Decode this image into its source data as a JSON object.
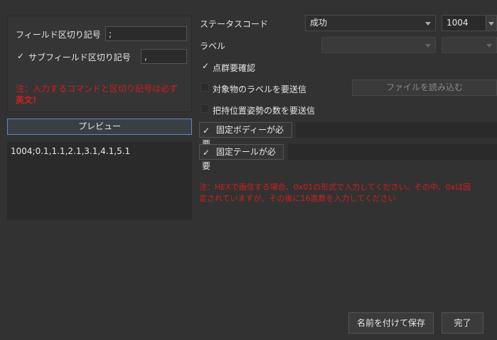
{
  "left": {
    "field_delimiter_label": "フィールド区切り記号",
    "field_delimiter_value": ";",
    "subfield_checkbox_checked": true,
    "subfield_delimiter_label": "サブフィールド区切り記号",
    "subfield_delimiter_value": ",",
    "note_line1": "注：入力するコマンドと区切り記号は必ず",
    "note_line2": "英文!",
    "preview_button": "プレビュー",
    "preview_text": "1004;0.1,1.1,2.1,3.1,4.1,5.1"
  },
  "right": {
    "status_code_label": "ステータスコード",
    "status_code_select": "成功",
    "status_code_value": "1004",
    "label_label": "ラベル",
    "point_cloud_confirm_label": "点群要確認",
    "point_cloud_confirm_checked": true,
    "send_label_label": "対象物のラベルを要送信",
    "send_label_checked": false,
    "load_file_button": "ファイルを読み込む",
    "send_pose_count_label": "把持位置姿勢の数を要送信",
    "send_pose_count_checked": false,
    "fixed_body_label": "固定ボディーが必要",
    "fixed_body_checked": true,
    "fixed_tail_label": "固定テールが必要",
    "fixed_tail_checked": true,
    "hex_note_line1": "注：HEXで画信する場合、0x01の形式で入力してください。その中、0xは固",
    "hex_note_line2": "定されていますが、その後に16進数を入力してください"
  },
  "footer": {
    "save_as_button": "名前を付けて保存",
    "done_button": "完了"
  },
  "colors": {
    "background": "#323232",
    "warning": "#d11f1f",
    "accent": "#5a8ac4"
  }
}
